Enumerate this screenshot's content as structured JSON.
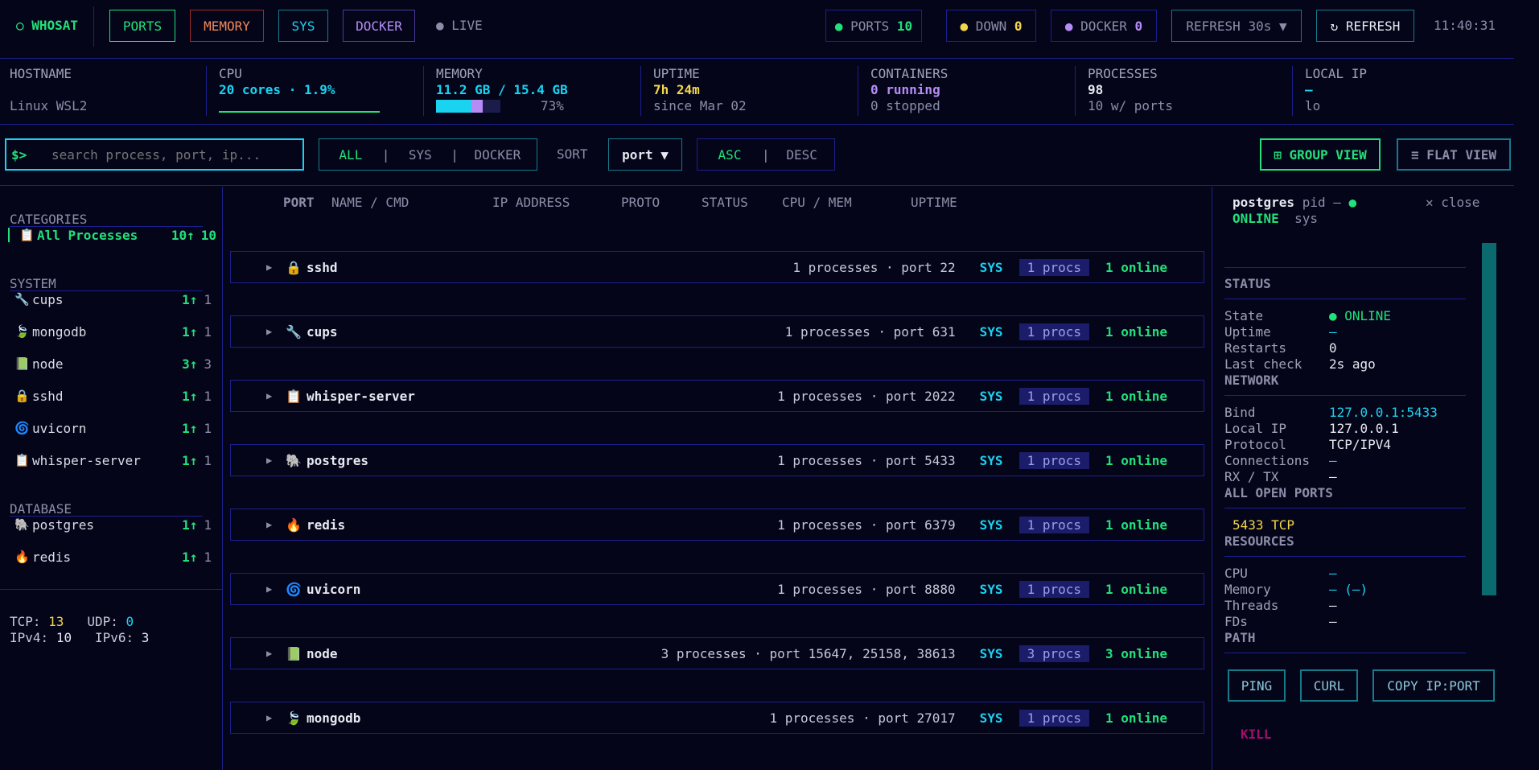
{
  "header": {
    "brand": "○ WHOSAT",
    "tabs": [
      {
        "label": "PORTS"
      },
      {
        "label": "MEMORY"
      },
      {
        "label": "SYS"
      },
      {
        "label": "DOCKER"
      }
    ],
    "live": "● LIVE",
    "counters": [
      {
        "dot": "●",
        "label": "PORTS",
        "value": "10"
      },
      {
        "dot": "●",
        "label": "DOWN",
        "value": "0"
      },
      {
        "dot": "●",
        "label": "DOCKER",
        "value": "0"
      }
    ],
    "refresh_select": "REFRESH 30s ▼",
    "refresh_button": "↻ REFRESH",
    "clock": "11:40:31"
  },
  "stats": [
    {
      "label": "HOSTNAME",
      "v1": "",
      "v2": "Linux WSL2"
    },
    {
      "label": "CPU",
      "v1": "20 cores · 1.9%",
      "v2": ""
    },
    {
      "label": "MEMORY",
      "v1": "11.2 GB / 15.4 GB",
      "v2": "73%"
    },
    {
      "label": "UPTIME",
      "v1": "7h 24m",
      "v2": "since Mar 02"
    },
    {
      "label": "CONTAINERS",
      "v1": "0 running",
      "v2": "0 stopped"
    },
    {
      "label": "PROCESSES",
      "v1": "98",
      "v2": "10 w/ ports"
    },
    {
      "label": "LOCAL IP",
      "v1": "–",
      "v2": "lo"
    }
  ],
  "memory_fill_percent": 73,
  "search": {
    "prompt": "$>",
    "placeholder": "search process, port, ip..."
  },
  "filters": [
    "ALL",
    "SYS",
    "DOCKER"
  ],
  "sort": {
    "label": "SORT",
    "value": "port ▼"
  },
  "order": [
    "ASC",
    "DESC"
  ],
  "views": {
    "group": "⊞ GROUP VIEW",
    "flat": "≡ FLAT VIEW"
  },
  "sidebar": {
    "categories_title": "CATEGORIES",
    "all": {
      "icon": "📋",
      "label": "All Processes",
      "count": "10↑",
      "total": "10"
    },
    "system_title": "SYSTEM",
    "system": [
      {
        "icon": "🔧",
        "label": "cups",
        "count": "1↑",
        "total": "1"
      },
      {
        "icon": "🍃",
        "label": "mongodb",
        "count": "1↑",
        "total": "1"
      },
      {
        "icon": "📗",
        "label": "node",
        "count": "3↑",
        "total": "3"
      },
      {
        "icon": "🔒",
        "label": "sshd",
        "count": "1↑",
        "total": "1"
      },
      {
        "icon": "🌀",
        "label": "uvicorn",
        "count": "1↑",
        "total": "1"
      },
      {
        "icon": "📋",
        "label": "whisper-server",
        "count": "1↑",
        "total": "1"
      }
    ],
    "database_title": "DATABASE",
    "database": [
      {
        "icon": "🐘",
        "label": "postgres",
        "count": "1↑",
        "total": "1"
      },
      {
        "icon": "🔥",
        "label": "redis",
        "count": "1↑",
        "total": "1"
      }
    ],
    "proto": {
      "tcp_label": "TCP:",
      "tcp": "13",
      "udp_label": "UDP:",
      "udp": "0",
      "ipv4_label": "IPv4:",
      "ipv4": "10",
      "ipv6_label": "IPv6:",
      "ipv6": "3"
    }
  },
  "columns": [
    "PORT",
    "NAME / CMD",
    "IP ADDRESS",
    "PROTO",
    "STATUS",
    "CPU / MEM",
    "UPTIME"
  ],
  "groups": [
    {
      "icon": "🔒",
      "name": "sshd",
      "info": "1 processes · port 22",
      "tag": "SYS",
      "procs": "1 procs",
      "online": "1 online"
    },
    {
      "icon": "🔧",
      "name": "cups",
      "info": "1 processes · port 631",
      "tag": "SYS",
      "procs": "1 procs",
      "online": "1 online"
    },
    {
      "icon": "📋",
      "name": "whisper-server",
      "info": "1 processes · port 2022",
      "tag": "SYS",
      "procs": "1 procs",
      "online": "1 online"
    },
    {
      "icon": "🐘",
      "name": "postgres",
      "info": "1 processes · port 5433",
      "tag": "SYS",
      "procs": "1 procs",
      "online": "1 online"
    },
    {
      "icon": "🔥",
      "name": "redis",
      "info": "1 processes · port 6379",
      "tag": "SYS",
      "procs": "1 procs",
      "online": "1 online"
    },
    {
      "icon": "🌀",
      "name": "uvicorn",
      "info": "1 processes · port 8880",
      "tag": "SYS",
      "procs": "1 procs",
      "online": "1 online"
    },
    {
      "icon": "📗",
      "name": "node",
      "info": "3 processes · port 15647, 25158, 38613",
      "tag": "SYS",
      "procs": "3 procs",
      "online": "3 online"
    },
    {
      "icon": "🍃",
      "name": "mongodb",
      "info": "1 processes · port 27017",
      "tag": "SYS",
      "procs": "1 procs",
      "online": "1 online"
    }
  ],
  "detail": {
    "name": "postgres",
    "pid": "pid –",
    "dot": "●",
    "close": "✕ close",
    "status_word": "ONLINE",
    "kind": "sys",
    "status_title": "STATUS",
    "state_label": "State",
    "state": "● ONLINE",
    "uptime_label": "Uptime",
    "uptime": "–",
    "restarts_label": "Restarts",
    "restarts": "0",
    "lastcheck_label": "Last check",
    "lastcheck": "2s ago",
    "network_title": "NETWORK",
    "bind_label": "Bind",
    "bind": "127.0.0.1:5433",
    "localip_label": "Local IP",
    "localip": "127.0.0.1",
    "protocol_label": "Protocol",
    "protocol": "TCP/IPV4",
    "connections_label": "Connections",
    "connections": "–",
    "rxtx_label": "RX / TX",
    "rxtx": "–",
    "ports_title": "ALL OPEN PORTS",
    "open_port": "5433 TCP",
    "resources_title": "RESOURCES",
    "cpu_label": "CPU",
    "cpu": "–",
    "memory_label": "Memory",
    "memory": "– (–)",
    "threads_label": "Threads",
    "threads": "–",
    "fds_label": "FDs",
    "fds": "–",
    "path_title": "PATH",
    "actions": [
      "PING",
      "CURL",
      "COPY IP:PORT"
    ],
    "kill": "KILL"
  }
}
